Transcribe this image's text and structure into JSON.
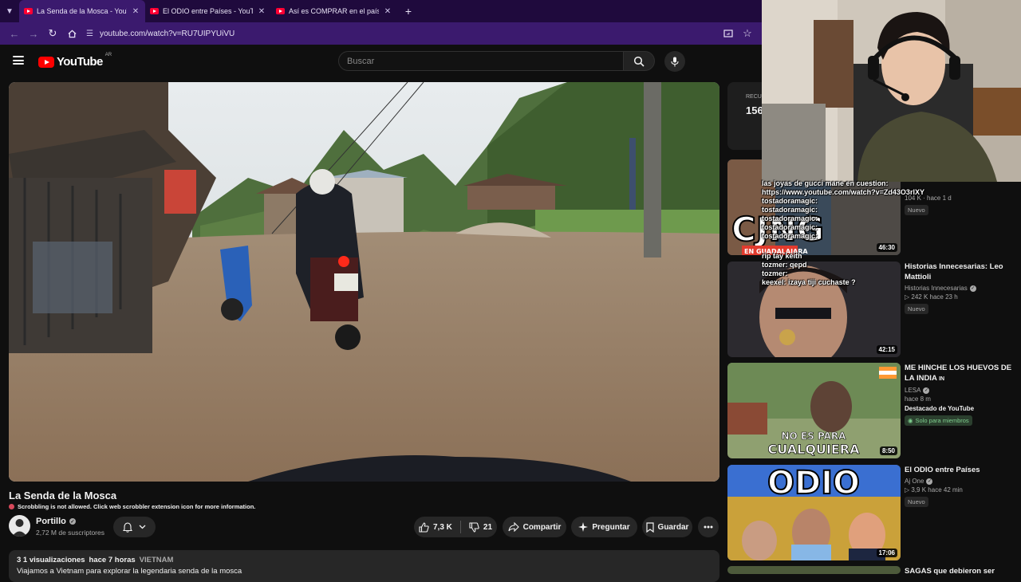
{
  "browser": {
    "tabs": [
      {
        "title": "La Senda de la Mosca - YouTube",
        "active": true
      },
      {
        "title": "El ODIO entre Países - YouTube",
        "active": false
      },
      {
        "title": "Así es COMPRAR en el país MÁS",
        "active": false
      }
    ],
    "url": "youtube.com/watch?v=RU7UIPYUiVU"
  },
  "youtube": {
    "logo_text": "YouTube",
    "country": "AR",
    "search_placeholder": "Buscar"
  },
  "video": {
    "title": "La Senda de la Mosca",
    "scrobble_notice": "Scrobbling is not allowed. Click web scrobbler extension icon for more information.",
    "channel": "Portillo",
    "subscribers": "2,72 M de suscriptores",
    "likes": "7,3 K",
    "dislikes": "21",
    "share_label": "Compartir",
    "ask_label": "Preguntar",
    "save_label": "Guardar",
    "views": "3 1 visualizaciones",
    "posted": "hace 7 horas",
    "tag": "VIETNAM",
    "description": "Viajamos a Vietnam para explorar la legendaria senda de la mosca"
  },
  "recording_box": {
    "label": "RECU",
    "value": "156"
  },
  "recommendations": [
    {
      "title": "",
      "channel": "",
      "views": "104 K",
      "age": "hace 1 d",
      "badge": "Nuevo",
      "duration": "46:30",
      "thumb_text": "CJNG",
      "thumb_sub": "EN GUADALAJARA"
    },
    {
      "title": "Historias Innecesarias: Leo Mattioli",
      "channel": "Historias Innecesarias",
      "views": "242 K",
      "age": "hace 23 h",
      "badge": "Nuevo",
      "duration": "42:15"
    },
    {
      "title": "ME HINCHE LOS HUEVOS DE LA INDIA",
      "title_suffix": "IN",
      "channel": "LESA",
      "age": "hace 8 m",
      "featured": "Destacado de YouTube",
      "members": "Solo para miembros",
      "duration": "8:50",
      "thumb_text": "NO ES PARA",
      "thumb_sub": "CUALQUIERA"
    },
    {
      "title": "El ODIO entre Países",
      "channel": "Aj One",
      "views": "3,9 K",
      "age": "hace 42 min",
      "badge": "Nuevo",
      "duration": "17:06",
      "thumb_text": "ODIO"
    },
    {
      "title": "SAGAS que debieron ser"
    }
  ],
  "chat": [
    {
      "user": "",
      "text": "las joyas de gucci mane en cuestion:"
    },
    {
      "user": "",
      "text": "https://www.youtube.com/watch?v=Zd43O3rlXY"
    },
    {
      "user": "tostadoramagic:",
      "text": ""
    },
    {
      "user": "tostadoramagic:",
      "text": ""
    },
    {
      "user": "tostadoramagic:",
      "text": ""
    },
    {
      "user": "tostadoramagic:",
      "text": ""
    },
    {
      "user": "tostadoramagic:",
      "text": ""
    },
    {
      "user": "",
      "text": "rip tay keith"
    },
    {
      "user": "tozmer:",
      "text": "qepd"
    },
    {
      "user": "tozmer:",
      "text": ""
    },
    {
      "user": "keexel:",
      "text": "izaya tiji cuchaste ?"
    }
  ]
}
